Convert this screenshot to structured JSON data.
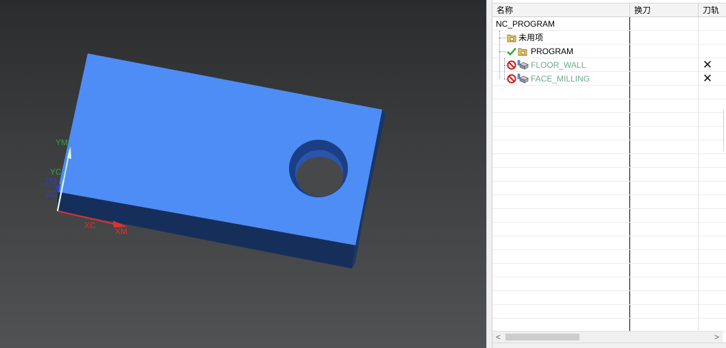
{
  "viewport": {
    "axis_labels": {
      "ym": "YM",
      "yc": "YC",
      "zm": "ZM",
      "zc": "ZC",
      "xc": "XC",
      "xm": "XM"
    },
    "colors": {
      "part_top": "#4e8df5",
      "part_side_front": "#17315d",
      "part_side_right": "#1d3a6d",
      "x_axis": "#e03030",
      "y_axis": "#3aa04a",
      "z_axis": "#2f3fbf"
    }
  },
  "navigator": {
    "columns": [
      "名称",
      "换刀",
      "刀轨"
    ],
    "rows": [
      {
        "name": "NC_PROGRAM",
        "status_icon": "",
        "type_icon": "",
        "path_mark": "",
        "dim": false
      },
      {
        "name": "未用项",
        "status_icon": "",
        "type_icon": "folder-icon",
        "path_mark": "",
        "dim": false
      },
      {
        "name": "PROGRAM",
        "status_icon": "check-icon",
        "type_icon": "folder-icon",
        "path_mark": "",
        "dim": false
      },
      {
        "name": "FLOOR_WALL",
        "status_icon": "no-entry-icon",
        "type_icon": "mill-operation-icon",
        "path_mark": "✕",
        "dim": true
      },
      {
        "name": "FACE_MILLING",
        "status_icon": "no-entry-icon",
        "type_icon": "mill-operation-icon",
        "path_mark": "✕",
        "dim": true
      }
    ],
    "scroll": {
      "left_arrow": "<",
      "right_arrow": ">"
    }
  }
}
